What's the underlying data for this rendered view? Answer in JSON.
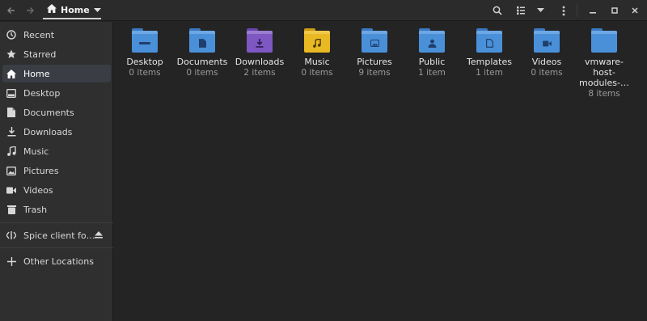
{
  "header": {
    "path_label": "Home",
    "icons": [
      "back-arrow-icon",
      "forward-arrow-icon",
      "home-icon",
      "chevron-down-icon",
      "search-icon",
      "view-list-icon",
      "view-options-chevron-icon",
      "menu-kebab-icon",
      "minimize-icon",
      "maximize-icon",
      "close-icon"
    ]
  },
  "sidebar": {
    "items": [
      {
        "label": "Recent",
        "icon": "clock-icon"
      },
      {
        "label": "Starred",
        "icon": "star-icon"
      },
      {
        "label": "Home",
        "icon": "home-icon",
        "active": true
      },
      {
        "label": "Desktop",
        "icon": "desktop-icon"
      },
      {
        "label": "Documents",
        "icon": "document-icon"
      },
      {
        "label": "Downloads",
        "icon": "download-icon"
      },
      {
        "label": "Music",
        "icon": "music-icon"
      },
      {
        "label": "Pictures",
        "icon": "picture-icon"
      },
      {
        "label": "Videos",
        "icon": "video-icon"
      },
      {
        "label": "Trash",
        "icon": "trash-icon"
      }
    ],
    "devices": [
      {
        "label": "Spice client fo…",
        "icon": "spice-share-icon",
        "eject_icon": "eject-icon"
      }
    ],
    "other": {
      "label": "Other Locations",
      "icon": "plus-icon"
    }
  },
  "files": [
    {
      "name": "Desktop",
      "count": "0 items",
      "color": "#4a90d9",
      "emblem": "desktop"
    },
    {
      "name": "Documents",
      "count": "0 items",
      "color": "#4a90d9",
      "emblem": "document"
    },
    {
      "name": "Downloads",
      "count": "2 items",
      "color": "#7e57c2",
      "emblem": "download"
    },
    {
      "name": "Music",
      "count": "0 items",
      "color": "#e8b923",
      "emblem": "music"
    },
    {
      "name": "Pictures",
      "count": "9 items",
      "color": "#4a90d9",
      "emblem": "picture"
    },
    {
      "name": "Public",
      "count": "1 item",
      "color": "#4a90d9",
      "emblem": "person"
    },
    {
      "name": "Templates",
      "count": "1 item",
      "color": "#4a90d9",
      "emblem": "template"
    },
    {
      "name": "Videos",
      "count": "0 items",
      "color": "#4a90d9",
      "emblem": "video"
    },
    {
      "name_lines": [
        "vmware-",
        "host-",
        "modules-…"
      ],
      "count": "8 items",
      "color": "#4a90d9",
      "emblem": "none"
    }
  ]
}
